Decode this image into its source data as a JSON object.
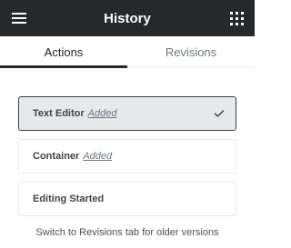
{
  "header": {
    "title": "History",
    "menu_icon": "hamburger-menu-icon",
    "grid_icon": "apps-grid-icon",
    "background_color": "#26292c"
  },
  "tabs": [
    {
      "label": "Actions",
      "active": true
    },
    {
      "label": "Revisions",
      "active": false
    }
  ],
  "history": {
    "items": [
      {
        "title": "Text Editor",
        "action": "Added",
        "active": true,
        "icon": "check-icon"
      },
      {
        "title": "Container",
        "action": "Added",
        "active": false
      },
      {
        "title": "Editing Started",
        "action": "",
        "active": false
      }
    ]
  },
  "footer": {
    "note": "Switch to Revisions tab for older versions"
  }
}
